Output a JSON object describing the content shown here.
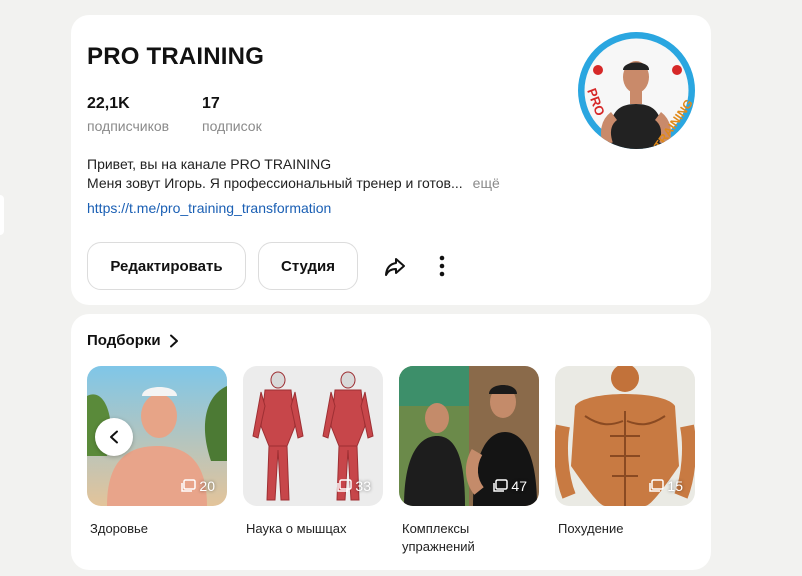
{
  "profile": {
    "channel_name": "PRO TRAINING",
    "subscribers_value": "22,1K",
    "subscribers_label": "подписчиков",
    "following_value": "17",
    "following_label": "подписок",
    "description_line1": "Привет, вы на канале PRO TRAINING",
    "description_line2": "Меня зовут Игорь. Я профессиональный тренер и готов...",
    "more_label": "ещё",
    "link": "https://t.me/pro_training_transformation",
    "edit_label": "Редактировать",
    "studio_label": "Студия",
    "avatar_text": "PRO TRAINING"
  },
  "collections": {
    "heading": "Подборки",
    "items": [
      {
        "name": "Здоровье",
        "count": "20"
      },
      {
        "name": "Наука о мышцах",
        "count": "33"
      },
      {
        "name": "Комплексы упражнений",
        "count": "47"
      },
      {
        "name": "Похудение",
        "count": "15"
      }
    ]
  },
  "colors": {
    "link": "#1a5fb4",
    "muted": "#8a8a8a",
    "avatar_ring": "#2aa6e0"
  }
}
